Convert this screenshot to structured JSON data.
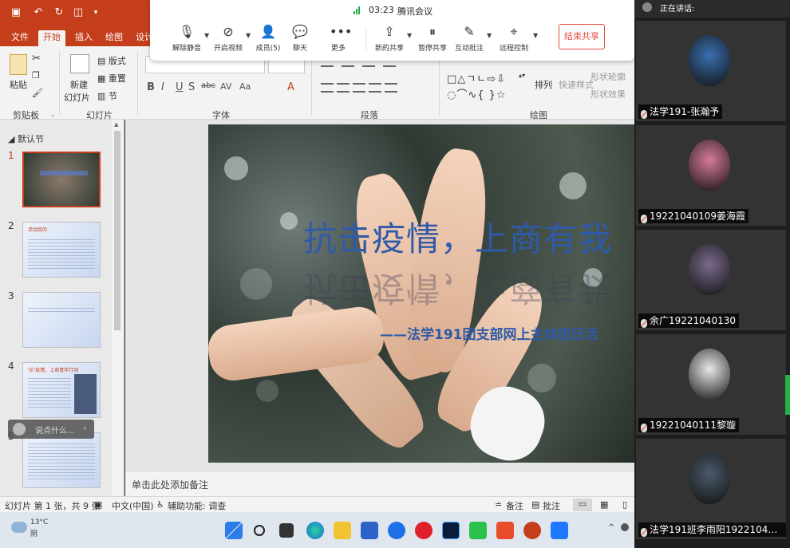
{
  "ppt": {
    "tabs": [
      "文件",
      "开始",
      "插入",
      "绘图",
      "设计"
    ],
    "active_tab": "开始",
    "groups": {
      "clipboard": "剪贴板",
      "slides": "幻灯片",
      "font": "字体",
      "paragraph": "段落",
      "drawing": "绘图"
    },
    "clipboard": {
      "paste": "粘贴"
    },
    "slides": {
      "new_slide_1": "新建",
      "new_slide_2": "幻灯片",
      "layout": "版式",
      "reset": "重置",
      "section": "节"
    },
    "font_buttons": [
      "B",
      "I",
      "U",
      "S",
      "abc",
      "AV",
      "Aa",
      "A"
    ],
    "drawing": {
      "arrange": "排列",
      "quick_styles": "快速样式",
      "shape_outline": "形状轮廓",
      "shape_effects": "形状效果"
    }
  },
  "meeting": {
    "time": "03:23",
    "app_name": "腾讯会议",
    "buttons": [
      {
        "label": "解除静音",
        "icon": "mic-muted-icon"
      },
      {
        "label": "开启视频",
        "icon": "camera-off-icon"
      },
      {
        "label": "成员(5)",
        "icon": "members-icon"
      },
      {
        "label": "聊天",
        "icon": "chat-icon"
      },
      {
        "label": "更多",
        "icon": "more-icon"
      },
      {
        "label": "新的共享",
        "icon": "share-icon"
      },
      {
        "label": "暂停共享",
        "icon": "pause-share-icon"
      },
      {
        "label": "互动批注",
        "icon": "annotate-icon"
      },
      {
        "label": "远程控制",
        "icon": "remote-control-icon"
      }
    ],
    "end_share": "结束共享",
    "say_something": "说点什么..."
  },
  "thumbnails": {
    "section": "默认节",
    "slides": [
      {
        "num": "1",
        "title": ""
      },
      {
        "num": "2",
        "title": "活动目的"
      },
      {
        "num": "3",
        "title": ""
      },
      {
        "num": "4",
        "title": "'抗'疫情，上商青年行动"
      },
      {
        "num": "5",
        "title": ""
      }
    ]
  },
  "slide": {
    "title": "抗击疫情，上商有我",
    "subtitle": "——法学191团支部网上主体团日活"
  },
  "notes_placeholder": "单击此处添加备注",
  "status": {
    "slide_info": "幻灯片 第 1 张，共 9 张",
    "language": "中文(中国)",
    "accessibility": "辅助功能: 调查",
    "notes": "备注",
    "comments": "批注"
  },
  "participants": {
    "header": "正在讲话:",
    "list": [
      {
        "name": "法学191-张瀚予",
        "avatar_color": "#3a6fb0"
      },
      {
        "name": "19221040109姜海霞",
        "avatar_color": "#d77a9a"
      },
      {
        "name": "余广19221040130",
        "avatar_color": "#7a6a8a"
      },
      {
        "name": "19221040111黎璇",
        "avatar_color": "#e8e8e8"
      },
      {
        "name": "法学191班李雨阳19221040...",
        "avatar_color": "#4a5a6a"
      }
    ]
  },
  "taskbar": {
    "weather_temp": "13°C",
    "weather_cond": "阴",
    "apps": [
      "windows-start-icon",
      "search-icon",
      "task-view-icon",
      "edge-icon",
      "file-explorer-icon",
      "store-icon",
      "lark-icon",
      "netease-music-icon",
      "photoshop-icon",
      "wechat-icon",
      "xmind-icon",
      "powerpoint-icon",
      "tencent-meeting-icon"
    ]
  }
}
